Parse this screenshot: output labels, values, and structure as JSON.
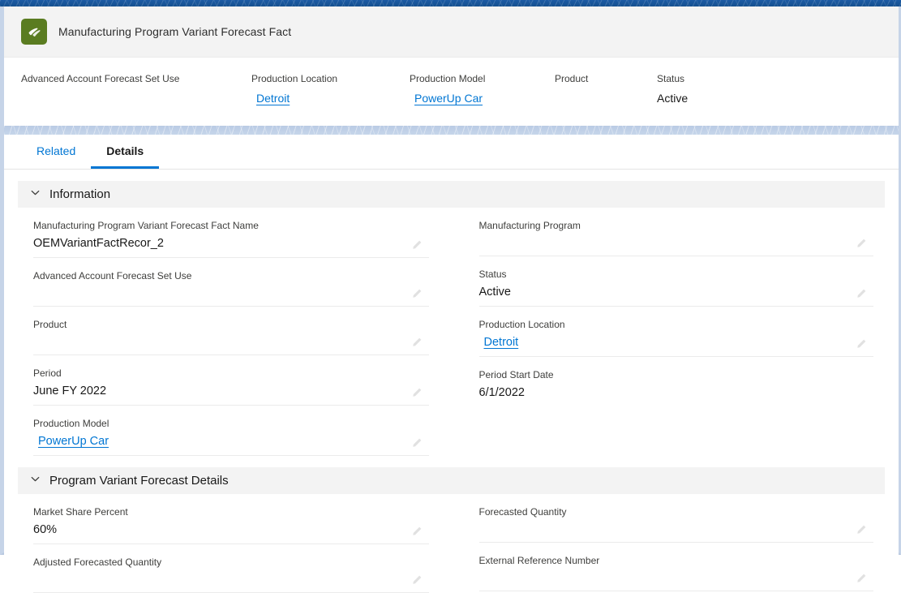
{
  "record": {
    "icon": "manufacturing-program-icon",
    "title": "Manufacturing Program Variant Forecast Fact"
  },
  "highlights": {
    "fields": [
      {
        "label": "Advanced Account Forecast Set Use",
        "value": "",
        "type": "text"
      },
      {
        "label": "Production Location",
        "value": "Detroit",
        "type": "link"
      },
      {
        "label": "Production Model",
        "value": "PowerUp Car",
        "type": "link"
      },
      {
        "label": "Product",
        "value": "",
        "type": "text"
      },
      {
        "label": "Status",
        "value": "Active",
        "type": "text"
      }
    ]
  },
  "tabs": [
    {
      "label": "Related",
      "active": false
    },
    {
      "label": "Details",
      "active": true
    }
  ],
  "sections": [
    {
      "name": "information",
      "title": "Information",
      "expanded": true,
      "left": [
        {
          "label": "Manufacturing Program Variant Forecast Fact Name",
          "value": "OEMVariantFactRecor_2",
          "type": "text",
          "editable": true
        },
        {
          "label": "Advanced Account Forecast Set Use",
          "value": "",
          "type": "text",
          "editable": true
        },
        {
          "label": "Product",
          "value": "",
          "type": "text",
          "editable": true
        },
        {
          "label": "Period",
          "value": "June FY 2022",
          "type": "text",
          "editable": true
        },
        {
          "label": "Production Model",
          "value": "PowerUp Car",
          "type": "link",
          "editable": true
        }
      ],
      "right": [
        {
          "label": "Manufacturing Program",
          "value": "",
          "type": "text",
          "editable": true
        },
        {
          "label": "Status",
          "value": "Active",
          "type": "text",
          "editable": true
        },
        {
          "label": "Production Location",
          "value": "Detroit",
          "type": "link",
          "editable": true
        },
        {
          "label": "Period Start Date",
          "value": "6/1/2022",
          "type": "text",
          "editable": false
        }
      ]
    },
    {
      "name": "program-variant-forecast-details",
      "title": "Program Variant Forecast Details",
      "expanded": true,
      "left": [
        {
          "label": "Market Share Percent",
          "value": "60%",
          "type": "text",
          "editable": true
        },
        {
          "label": "Adjusted Forecasted Quantity",
          "value": "",
          "type": "text",
          "editable": true
        }
      ],
      "right": [
        {
          "label": "Forecasted Quantity",
          "value": "",
          "type": "text",
          "editable": true
        },
        {
          "label": "External Reference Number",
          "value": "",
          "type": "text",
          "editable": true
        }
      ]
    }
  ],
  "colors": {
    "brand_blue": "#0176d3",
    "global_header": "#1b5297",
    "icon_green": "#5a7c21",
    "section_bg": "#f3f3f3"
  }
}
